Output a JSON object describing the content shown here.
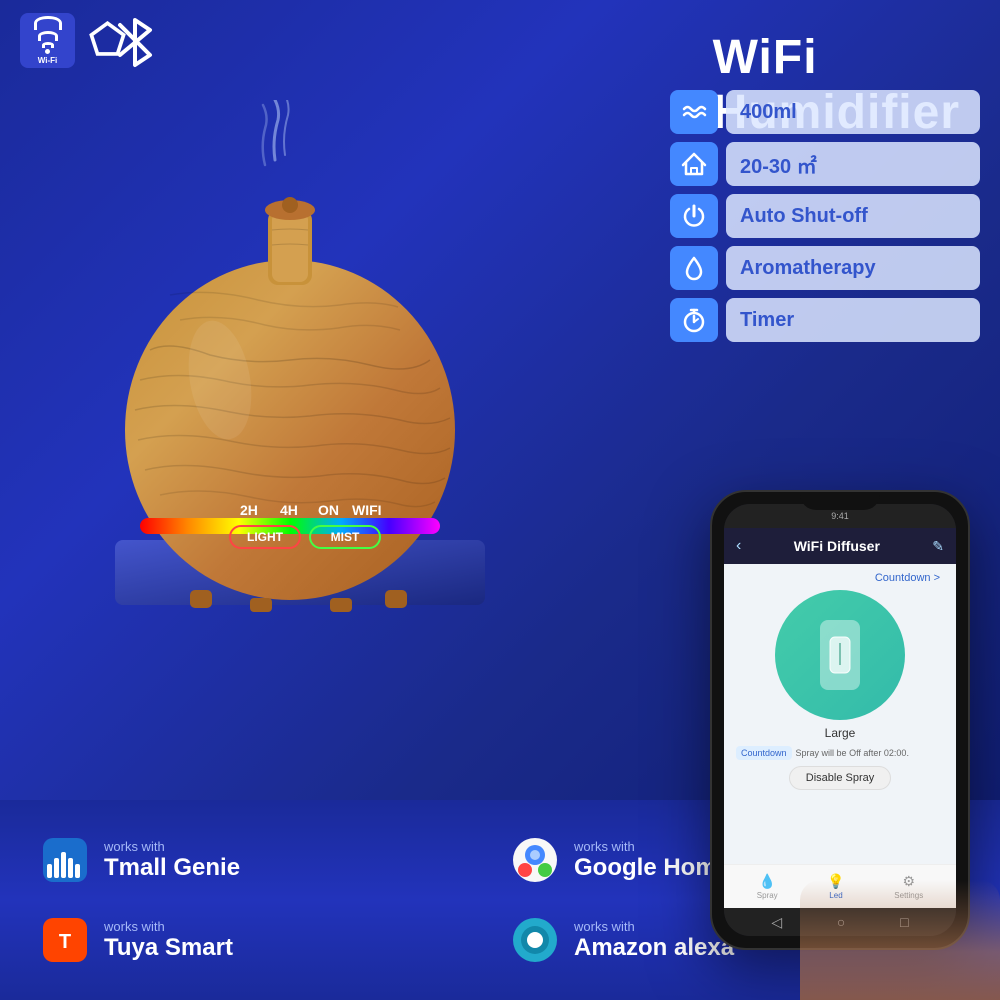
{
  "header": {
    "title": "WiFi Humidifier",
    "wifi_label": "Wi-Fi"
  },
  "features": [
    {
      "id": "capacity",
      "icon": "water-waves",
      "label": "400ml"
    },
    {
      "id": "coverage",
      "icon": "home",
      "label": "20-30 ㎡"
    },
    {
      "id": "autoshutoff",
      "icon": "power",
      "label": "Auto Shut-off"
    },
    {
      "id": "aromatherapy",
      "icon": "droplet",
      "label": "Aromatherapy"
    },
    {
      "id": "timer",
      "icon": "timer",
      "label": "Timer"
    }
  ],
  "product": {
    "button_light": "LIGHT",
    "button_mist": "MIST",
    "timer_2h": "2H",
    "timer_4h": "4H",
    "timer_on": "ON",
    "timer_wifi": "WIFI"
  },
  "compatible": [
    {
      "id": "tmall",
      "works_with": "works with",
      "brand": "Tmall Genie"
    },
    {
      "id": "google",
      "works_with": "works with",
      "brand": "Google Home"
    },
    {
      "id": "tuya",
      "works_with": "works with",
      "brand": "Tuya Smart"
    },
    {
      "id": "alexa",
      "works_with": "works with",
      "brand": "Amazon alexa"
    }
  ],
  "phone": {
    "title": "WiFi Diffuser",
    "countdown_label": "Countdown >",
    "size_label": "Large",
    "spray_countdown": "Countdown",
    "spray_info": "Spray will be Off after 02:00.",
    "disable_btn": "Disable Spray",
    "bottom_spray": "Spray",
    "bottom_led": "Led",
    "bottom_settings": "Settings"
  }
}
